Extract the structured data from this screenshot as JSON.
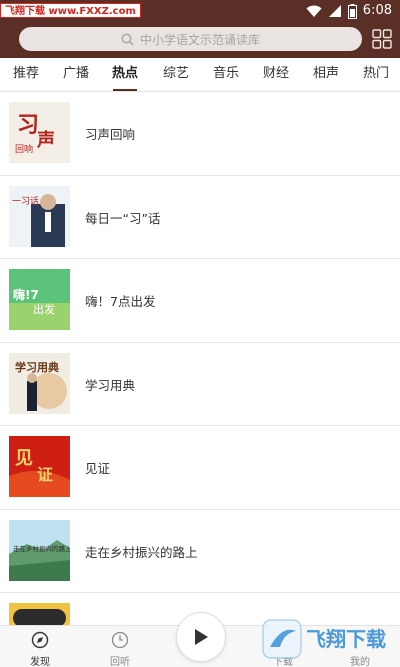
{
  "status_bar": {
    "watermark": "飞翔下载 www.FXXZ.com",
    "time": "6:08"
  },
  "header": {
    "search_placeholder": "中小学语文示范诵读库",
    "grid_icon": "grid-icon"
  },
  "tabs": [
    {
      "label": "推荐",
      "active": false
    },
    {
      "label": "广播",
      "active": false
    },
    {
      "label": "热点",
      "active": true
    },
    {
      "label": "综艺",
      "active": false
    },
    {
      "label": "音乐",
      "active": false
    },
    {
      "label": "财经",
      "active": false
    },
    {
      "label": "相声",
      "active": false
    },
    {
      "label": "热门",
      "active": false
    }
  ],
  "list": {
    "items": [
      {
        "title": "习声回响",
        "thumb_text": "习声"
      },
      {
        "title": "每日一“习”话",
        "thumb_text": "一习话"
      },
      {
        "title": "嗨！7点出发",
        "thumb_text": "嗨！7点出发"
      },
      {
        "title": "学习用典",
        "thumb_text": "学习用典"
      },
      {
        "title": "见证",
        "thumb_text": "见证"
      },
      {
        "title": "走在乡村振兴的路上",
        "thumb_text": "走在乡村振兴的路上"
      },
      {
        "title": "",
        "thumb_text": ""
      }
    ]
  },
  "bottom_nav": {
    "discover": "发现",
    "listen_back": "回听",
    "download": "下载",
    "mine": "我的"
  },
  "watermark2": "飞翔下载",
  "colors": {
    "brand": "#5a2f25",
    "tab_underline": "#5a2f25"
  }
}
